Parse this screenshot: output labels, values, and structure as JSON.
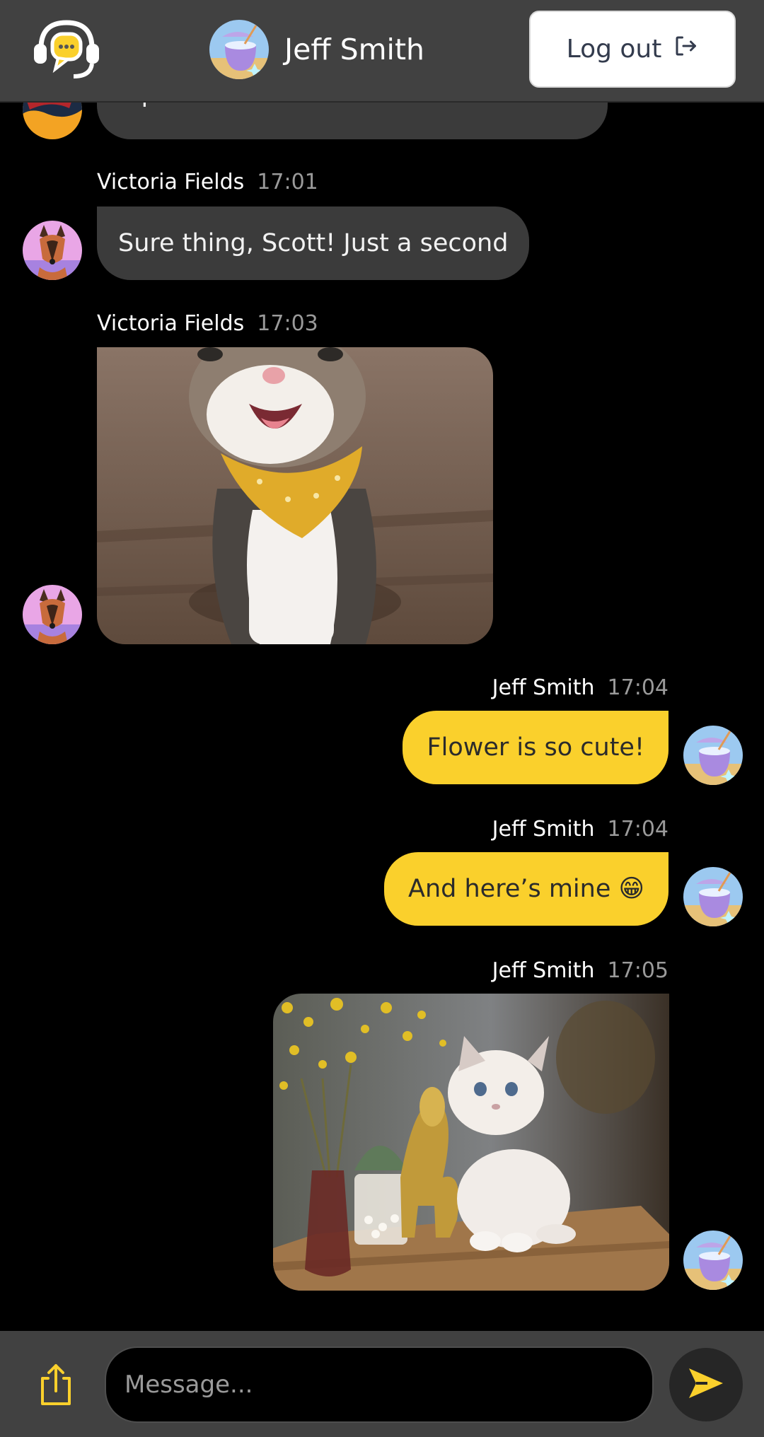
{
  "header": {
    "user_name": "Jeff Smith",
    "logout_label": "Log out"
  },
  "messages": [
    {
      "sender": "",
      "time": "",
      "type": "text",
      "text": "a picture of her?",
      "direction": "in"
    },
    {
      "sender": "Victoria Fields",
      "time": "17:01",
      "type": "text",
      "text": "Sure thing, Scott! Just a second",
      "direction": "in"
    },
    {
      "sender": "Victoria Fields",
      "time": "17:03",
      "type": "image",
      "image": "cat-with-yellow-bandana-photo",
      "direction": "in"
    },
    {
      "sender": "Jeff Smith",
      "time": "17:04",
      "type": "text",
      "text": "Flower is so cute!",
      "direction": "out"
    },
    {
      "sender": "Jeff Smith",
      "time": "17:04",
      "type": "text",
      "text": "And here’s mine 😁",
      "direction": "out"
    },
    {
      "sender": "Jeff Smith",
      "time": "17:05",
      "type": "image",
      "image": "white-kitten-on-table-photo",
      "direction": "out"
    }
  ],
  "composer": {
    "placeholder": "Message..."
  },
  "colors": {
    "accent": "#fad02c",
    "header_bg": "#414141",
    "incoming_bubble": "#3b3b3b",
    "page_bg": "#000000"
  },
  "icons": [
    "chat-support-logo-icon",
    "logout-icon",
    "upload-icon",
    "send-icon"
  ]
}
